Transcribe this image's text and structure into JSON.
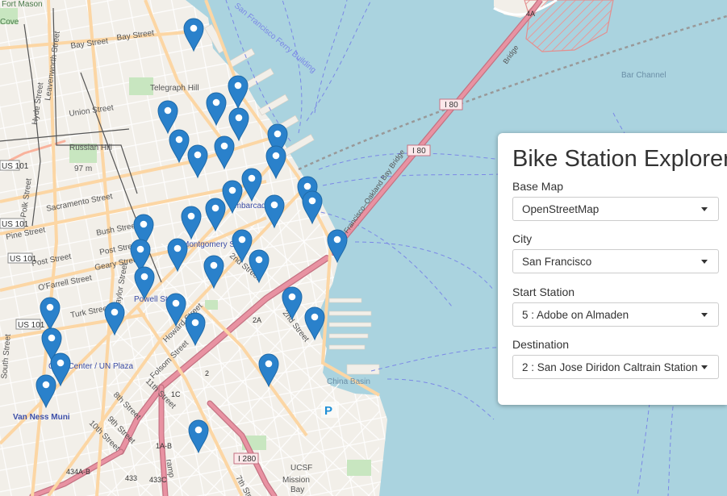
{
  "panel": {
    "title": "Bike Station Explorer",
    "fields": [
      {
        "label": "Base Map",
        "value": "OpenStreetMap"
      },
      {
        "label": "City",
        "value": "San Francisco"
      },
      {
        "label": "Start Station",
        "value": "5 : Adobe on Almaden"
      },
      {
        "label": "Destination",
        "value": "2 : San Jose Diridon Caltrain Station"
      }
    ]
  },
  "map_labels": {
    "fort_mason": "Fort Mason",
    "cove": "Cove",
    "bay_street_1": "Bay Street",
    "bay_street_2": "Bay Street",
    "leavenworth": "Leavenworth Street",
    "hyde": "Hyde Street",
    "union": "Union Street",
    "telegraph_hill": "Telegraph Hill",
    "russian_hill": "Russian Hill",
    "russian_hill_elev": "97 m",
    "ferry_building": "San Francisco Ferry Building",
    "bridge": "San Francisco–Oakland Bay Bridge",
    "bridge_short": "Bridge",
    "bar_channel": "Bar Channel",
    "i80_1": "I 80",
    "i80_2": "I 80",
    "us101_1": "US 101",
    "us101_2": "US 101",
    "us101_3": "US 101",
    "polk": "Polk Street",
    "sacramento": "Sacramento Street",
    "bush": "Bush Street",
    "pine": "Pine Street",
    "post_1": "Post Street",
    "post_2": "Post Street",
    "geary": "Geary Street",
    "ofarrell": "O'Farrell Street",
    "taylor": "Taylor Street",
    "turk": "Turk Street",
    "barcadero": "Embarcadero",
    "montgomery": "Montgomery St",
    "second_1": "2nd Street",
    "second_2": "2nd Street",
    "powell": "Powell St",
    "howard": "Howard Street",
    "folsom": "Folsom Street",
    "civic": "Civic Center / UN Plaza",
    "south": "South Street",
    "van_ness": "Van Ness Muni",
    "eighth": "8th Street",
    "ninth": "9th Street",
    "tenth": "10th Street",
    "eleventh": "11th Street",
    "route_1c": "1C",
    "route_2a": "2A",
    "route_2": "2",
    "route_1ab": "1A-B",
    "i280": "I 280",
    "r434": "434A-B",
    "r433": "433",
    "r433c": "433C",
    "ramp": "ramp",
    "ucsf": "UCSF",
    "mission_bay_1": "Mission",
    "mission_bay_2": "Bay",
    "china_basin": "China Basin",
    "parking": "P",
    "seventh": "7th Street",
    "route_4a": "4A"
  },
  "colors": {
    "water": "#aad3df",
    "land": "#f2efe9",
    "marker": "#2a81cb",
    "highway": "#e892a2",
    "primary": "#fcd6a4"
  },
  "marker_count": 36
}
